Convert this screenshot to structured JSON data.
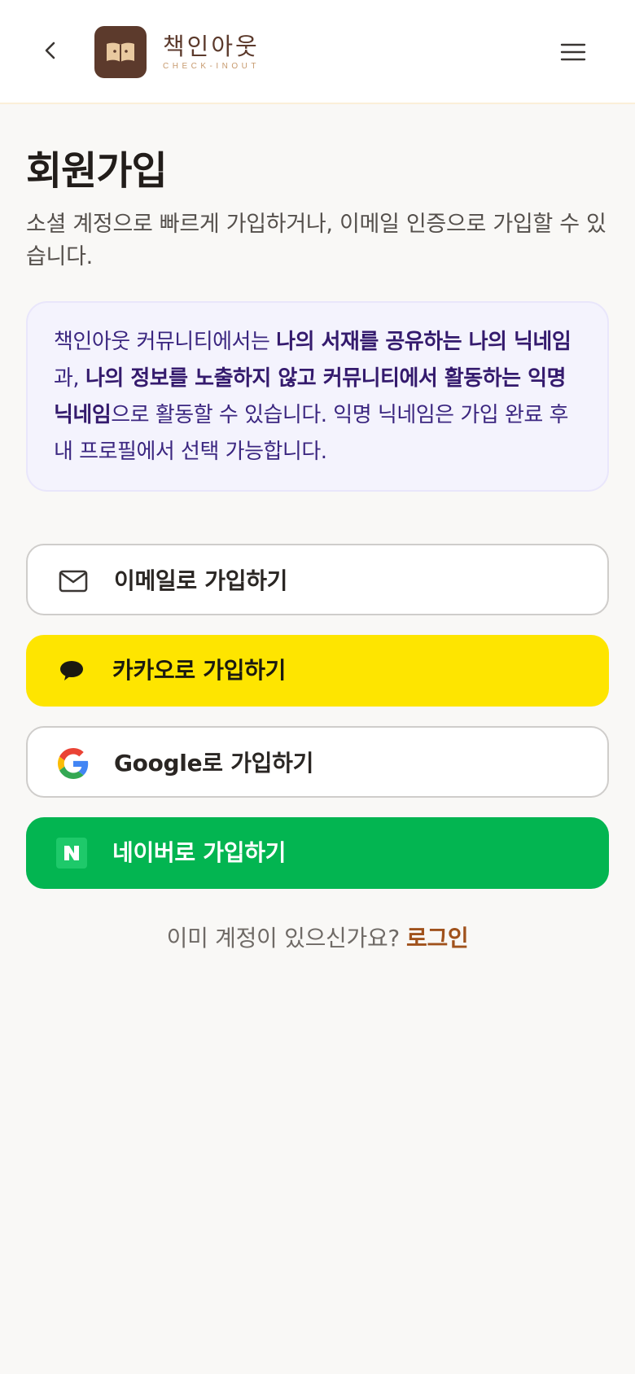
{
  "header": {
    "logo_name": "책인아웃",
    "logo_sub": "CHECK-INOUT"
  },
  "main": {
    "title": "회원가입",
    "description": "소셜 계정으로 빠르게 가입하거나, 이메일 인증으로 가입할 수 있습니다.",
    "notice": {
      "part1": "책인아웃 커뮤니티에서는 ",
      "bold1": "나의 서재를 공유하는 나의 닉네임",
      "part2": "과, ",
      "bold2": "나의 정보를 노출하지 않고 커뮤니티에서 활동하는 익명 닉네임",
      "part3": "으로 활동할 수 있습니다. 익명 닉네임은 가입 완료 후 내 프로필에서 선택 가능합니다."
    },
    "buttons": {
      "email": "이메일로 가입하기",
      "kakao": "카카오로 가입하기",
      "google": "Google로 가입하기",
      "naver": "네이버로 가입하기"
    },
    "login_prompt": "이미 계정이 있으신가요?",
    "login_link": "로그인"
  },
  "colors": {
    "kakao": "#FEE500",
    "naver": "#03B551",
    "logo_brown": "#5C3A2C",
    "login_link": "#A0521C",
    "notice_text": "#3B2680"
  },
  "icons": {
    "back": "chevron-left-icon",
    "menu": "hamburger-menu-icon",
    "logo": "open-book-icon",
    "email": "envelope-icon",
    "kakao": "speech-bubble-icon",
    "google": "google-g-icon",
    "naver": "naver-n-icon"
  }
}
